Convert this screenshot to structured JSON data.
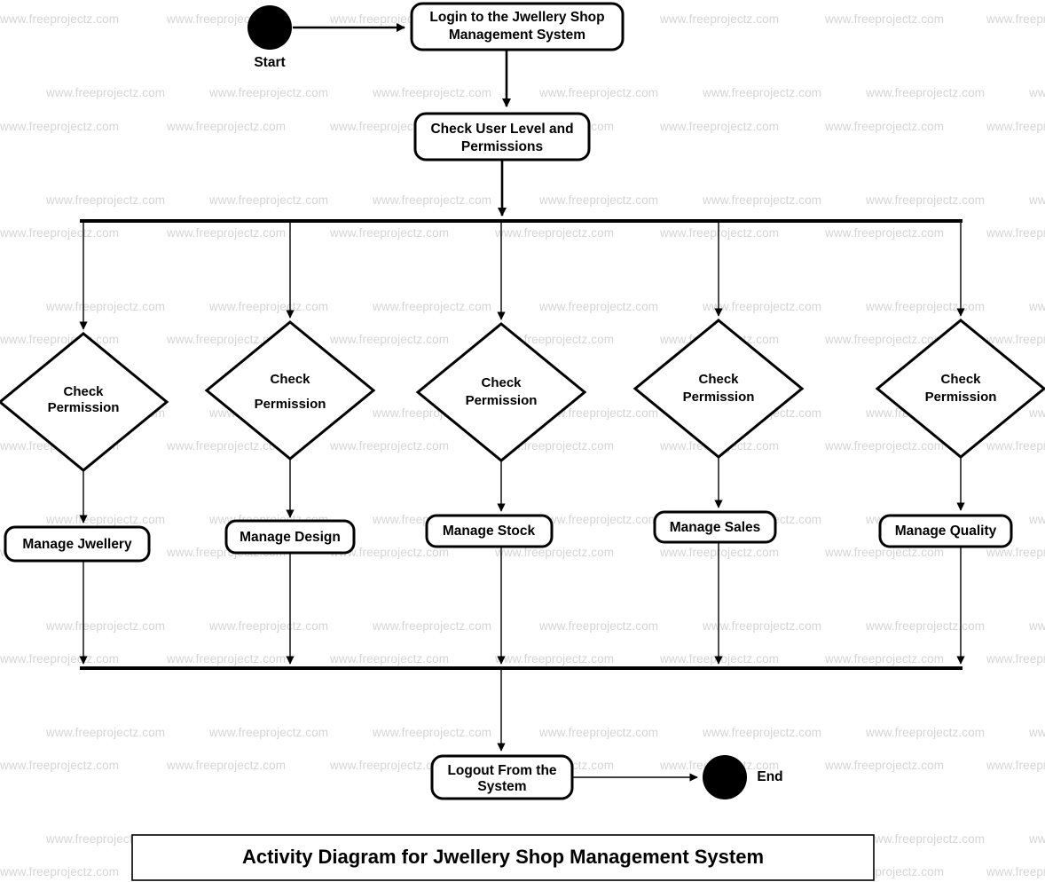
{
  "diagram": {
    "title": "Activity Diagram for Jwellery Shop Management System",
    "type": "uml-activity-diagram",
    "watermark_text": "www.freeprojectz.com",
    "colors": {
      "stroke": "#000000",
      "fill": "#ffffff",
      "watermark": "#d5d5d5"
    },
    "start_node": {
      "label": "Start",
      "shape": "filled-circle"
    },
    "end_node": {
      "label": "End",
      "shape": "filled-circle"
    },
    "activities": {
      "login": "Login to the Jwellery Shop Management System",
      "check_user": "Check User Level and Permissions",
      "logout": "Logout From the System"
    },
    "decisions": [
      {
        "id": "d1",
        "label": "Check Permission"
      },
      {
        "id": "d2",
        "label": "Check Permission"
      },
      {
        "id": "d3",
        "label": "Check Permission"
      },
      {
        "id": "d4",
        "label": "Check Permission"
      },
      {
        "id": "d5",
        "label": "Check Permission"
      }
    ],
    "manage_activities": [
      {
        "id": "m1",
        "label": "Manage Jwellery"
      },
      {
        "id": "m2",
        "label": "Manage Design"
      },
      {
        "id": "m3",
        "label": "Manage Stock"
      },
      {
        "id": "m4",
        "label": "Manage Sales"
      },
      {
        "id": "m5",
        "label": "Manage Quality"
      }
    ],
    "flow": [
      "Start -> Login to the Jwellery Shop Management System",
      "Login to the Jwellery Shop Management System -> Check User Level and Permissions",
      "Check User Level and Permissions -> Fork",
      "Fork -> Check Permission (x5)",
      "Check Permission -> Manage Jwellery",
      "Check Permission -> Manage Design",
      "Check Permission -> Manage Stock",
      "Check Permission -> Manage Sales",
      "Check Permission -> Manage Quality",
      "Manage activities -> Join",
      "Join -> Logout From the System",
      "Logout From the System -> End"
    ]
  }
}
